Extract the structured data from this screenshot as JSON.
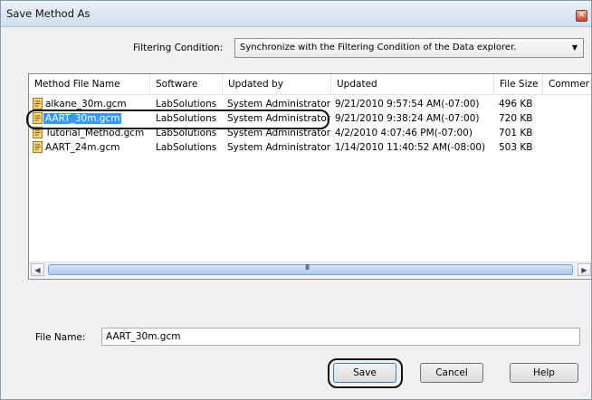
{
  "window": {
    "title": "Save Method As",
    "close_glyph": "✕"
  },
  "filter": {
    "label": "Filtering Condition:",
    "value": "Synchronize with the Filtering Condition of the Data explorer.",
    "arrow": "▼"
  },
  "table": {
    "columns": [
      "Method File Name",
      "Software",
      "Updated by",
      "Updated",
      "File Size",
      "Commer"
    ],
    "rows": [
      {
        "name": "alkane_30m.gcm",
        "software": "LabSolutions",
        "updated_by": "System Administrator",
        "updated": "9/21/2010 9:57:54 AM(-07:00)",
        "size": "496 KB"
      },
      {
        "name": "AART_30m.gcm",
        "software": "LabSolutions",
        "updated_by": "System Administrator",
        "updated": "9/21/2010 9:38:24 AM(-07:00)",
        "size": "720 KB",
        "selected": true
      },
      {
        "name": "Tutorial_Method.gcm",
        "software": "LabSolutions",
        "updated_by": "System Administrator",
        "updated": "4/2/2010 4:07:46 PM(-07:00)",
        "size": "701 KB"
      },
      {
        "name": "AART_24m.gcm",
        "software": "LabSolutions",
        "updated_by": "System Administrator",
        "updated": "1/14/2010 11:40:52 AM(-08:00)",
        "size": "503 KB"
      }
    ],
    "row_icon": "method-file-icon"
  },
  "scrollbar": {
    "left_arrow": "◀",
    "right_arrow": "▶",
    "grip": "III"
  },
  "file_name": {
    "label": "File Name:",
    "value": "AART_30m.gcm"
  },
  "buttons": {
    "save": "Save",
    "cancel": "Cancel",
    "help": "Help"
  },
  "colors": {
    "selection": "#3399ff",
    "title_bar": "#d2dff0"
  }
}
